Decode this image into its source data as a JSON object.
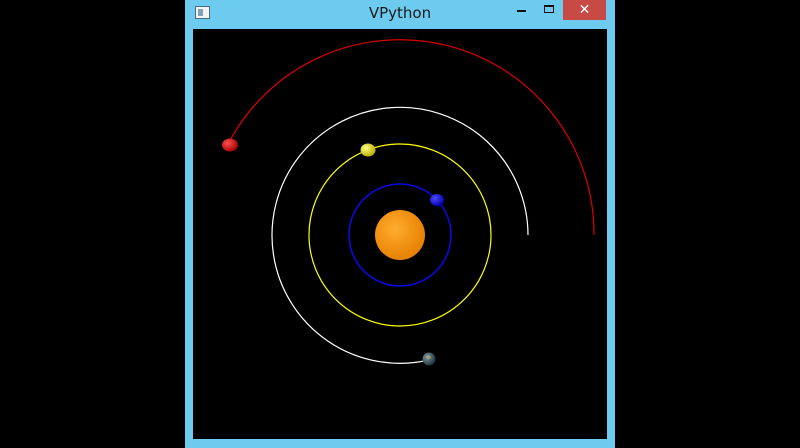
{
  "window": {
    "title": "VPython",
    "close_glyph": "✕",
    "icon": "app-window-icon"
  },
  "scene": {
    "background": "#000000",
    "sun_color": "#f7940a",
    "bodies": [
      {
        "name": "blue-planet",
        "orbit_color": "#0a0adc",
        "body_color": "#1010e0"
      },
      {
        "name": "yellow-planet",
        "orbit_color": "#ffff00",
        "body_color": "#f2e818"
      },
      {
        "name": "earth-planet",
        "orbit_color": "#ffffff",
        "body_color": "#36505a"
      },
      {
        "name": "red-planet",
        "orbit_color": "#e00000",
        "body_color": "#e00808"
      }
    ]
  }
}
